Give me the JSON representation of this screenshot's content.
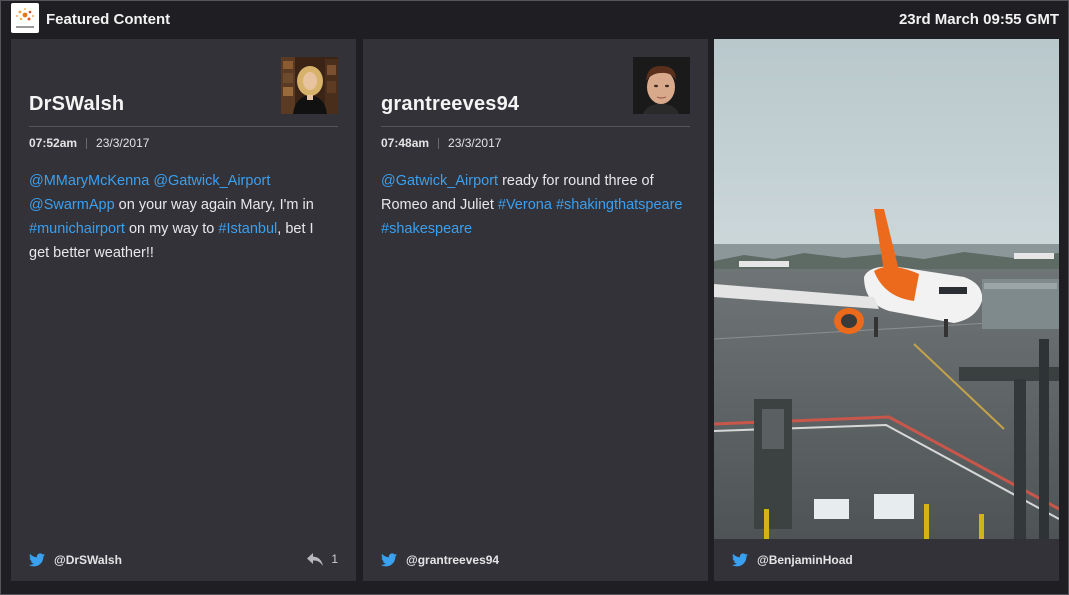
{
  "header": {
    "title": "Featured Content",
    "datetime": "23rd March 09:55 GMT"
  },
  "cards": [
    {
      "author": "DrSWalsh",
      "time": "07:52am",
      "date": "23/3/2017",
      "text_parts": [
        {
          "text": "@MMaryMcKenna",
          "link": true
        },
        {
          "text": " ",
          "link": false
        },
        {
          "text": "@Gatwick_Airport",
          "link": true
        },
        {
          "text": " ",
          "link": false
        },
        {
          "text": "@SwarmApp",
          "link": true
        },
        {
          "text": " on your way again Mary, I'm in ",
          "link": false
        },
        {
          "text": "#munichairport",
          "link": true
        },
        {
          "text": " on my way to ",
          "link": false
        },
        {
          "text": "#Istanbul",
          "link": true
        },
        {
          "text": ", bet I get better weather!!",
          "link": false
        }
      ],
      "handle": "@DrSWalsh",
      "reply_count": "1"
    },
    {
      "author": "grantreeves94",
      "time": "07:48am",
      "date": "23/3/2017",
      "text_parts": [
        {
          "text": "@Gatwick_Airport",
          "link": true
        },
        {
          "text": " ready for round three of Romeo and Juliet ",
          "link": false
        },
        {
          "text": "#Verona",
          "link": true
        },
        {
          "text": " ",
          "link": false
        },
        {
          "text": "#shakingthatspeare",
          "link": true
        },
        {
          "text": " ",
          "link": false
        },
        {
          "text": "#shakespeare",
          "link": true
        }
      ],
      "handle": "@grantreeves94"
    },
    {
      "handle": "@BenjaminHoad"
    }
  ],
  "colors": {
    "background": "#1f1e23",
    "card": "#333238",
    "link": "#3aa0f0",
    "twitter": "#3aa0f0"
  },
  "icons": [
    "app-logo-icon",
    "twitter-bird-icon",
    "reply-icon"
  ]
}
